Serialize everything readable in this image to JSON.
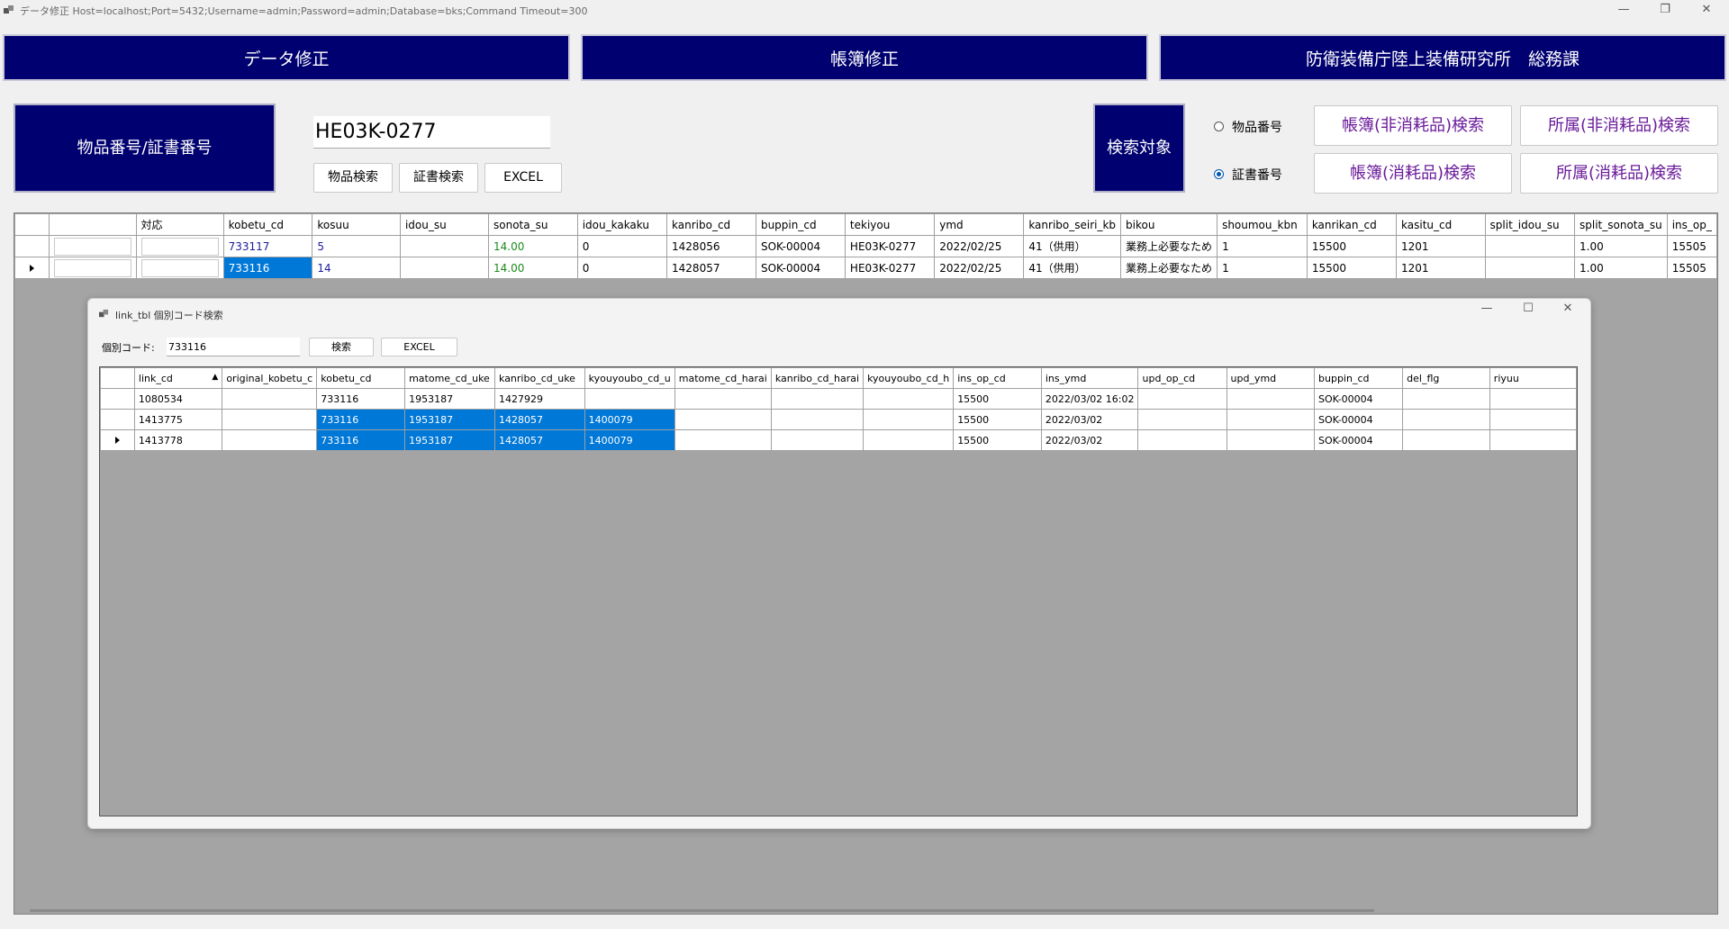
{
  "window": {
    "title": "データ修正 Host=localhost;Port=5432;Username=admin;Password=admin;Database=bks;Command Timeout=300",
    "icon": "app-window-icon",
    "controls": [
      "minimize",
      "restore",
      "close"
    ]
  },
  "nav": {
    "data_edit": "データ修正",
    "ledger_edit": "帳簿修正",
    "org": "防衛装備庁陸上装備研究所　総務課"
  },
  "search": {
    "label": "物品番号/証書番号",
    "value": "HE03K-0277",
    "item_search": "物品検索",
    "cert_search": "証書検索",
    "excel": "EXCEL",
    "target_label": "検索対象",
    "radio_item": "物品番号",
    "radio_cert": "証書番号",
    "radio_selected": "証書番号",
    "ledger_nonconsumable": "帳簿(非消耗品)検索",
    "dept_nonconsumable": "所属(非消耗品)検索",
    "ledger_consumable": "帳簿(消耗品)検索",
    "dept_consumable": "所属(消耗品)検索"
  },
  "main_grid": {
    "columns": [
      "",
      "対応",
      "kobetu_cd",
      "kosuu",
      "idou_su",
      "sonota_su",
      "idou_kakaku",
      "kanribo_cd",
      "buppin_cd",
      "tekiyou",
      "ymd",
      "kanribo_seiri_kb",
      "bikou",
      "shoumou_kbn",
      "kanrikan_cd",
      "kasitu_cd",
      "split_idou_su",
      "split_sonota_su",
      "ins_op_"
    ],
    "rows": [
      {
        "kobetu_cd": "733117",
        "kosuu": "5",
        "idou_su": "",
        "sonota_su": "14.00",
        "idou_kakaku": "0",
        "kanribo_cd": "1428056",
        "buppin_cd": "SOK-00004",
        "tekiyou": "HE03K-0277",
        "ymd": "2022/02/25",
        "kanribo_seiri_kb": "41（供用）",
        "bikou": "業務上必要なため",
        "shoumou_kbn": "1",
        "kanrikan_cd": "15500",
        "kasitu_cd": "1201",
        "split_idou_su": "",
        "split_sonota_su": "1.00",
        "ins_op": "15505"
      },
      {
        "kobetu_cd": "733116",
        "kosuu": "14",
        "idou_su": "",
        "sonota_su": "14.00",
        "idou_kakaku": "0",
        "kanribo_cd": "1428057",
        "buppin_cd": "SOK-00004",
        "tekiyou": "HE03K-0277",
        "ymd": "2022/02/25",
        "kanribo_seiri_kb": "41（供用）",
        "bikou": "業務上必要なため",
        "shoumou_kbn": "1",
        "kanrikan_cd": "15500",
        "kasitu_cd": "1201",
        "split_idou_su": "",
        "split_sonota_su": "1.00",
        "ins_op": "15505"
      }
    ]
  },
  "dialog": {
    "title": "link_tbl 個別コード検索",
    "code_label": "個別コード:",
    "code_value": "733116",
    "search": "検索",
    "excel": "EXCEL",
    "columns": [
      "link_cd",
      "original_kobetu_c",
      "kobetu_cd",
      "matome_cd_uke",
      "kanribo_cd_uke",
      "kyouyoubo_cd_u",
      "matome_cd_harai",
      "kanribo_cd_harai",
      "kyouyoubo_cd_h",
      "ins_op_cd",
      "ins_ymd",
      "upd_op_cd",
      "upd_ymd",
      "buppin_cd",
      "del_flg",
      "riyuu"
    ],
    "rows": [
      [
        "1080534",
        "",
        "733116",
        "1953187",
        "1427929",
        "",
        "",
        "",
        "",
        "15500",
        "2022/03/02 16:02",
        "",
        "",
        "SOK-00004",
        "",
        ""
      ],
      [
        "1413775",
        "",
        "733116",
        "1953187",
        "1428057",
        "1400079",
        "",
        "",
        "",
        "15500",
        "2022/03/02",
        "",
        "",
        "SOK-00004",
        "",
        ""
      ],
      [
        "1413778",
        "",
        "733116",
        "1953187",
        "1428057",
        "1400079",
        "",
        "",
        "",
        "15500",
        "2022/03/02",
        "",
        "",
        "SOK-00004",
        "",
        ""
      ]
    ]
  }
}
